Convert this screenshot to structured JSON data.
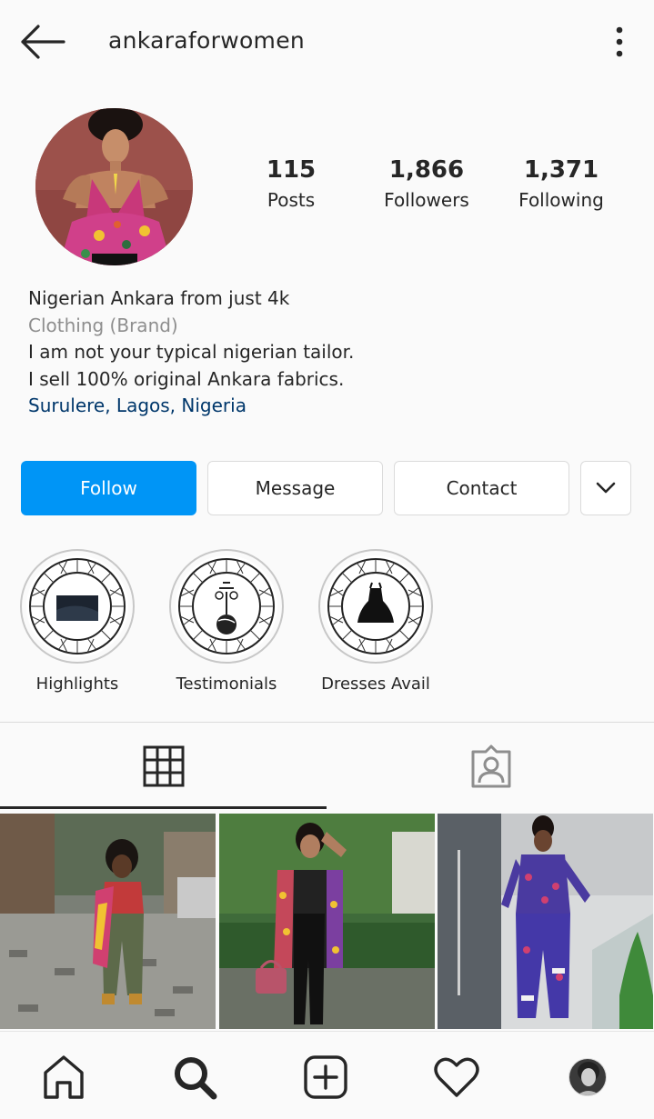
{
  "header": {
    "username": "ankaraforwomen",
    "back_icon": "arrow-left-icon",
    "more_icon": "more-vertical-icon"
  },
  "stats": {
    "posts_count": "115",
    "posts_label": "Posts",
    "followers_count": "1,866",
    "followers_label": "Followers",
    "following_count": "1,371",
    "following_label": "Following"
  },
  "bio": {
    "name": "Nigerian Ankara from just 4k",
    "category": "Clothing (Brand)",
    "line1": "I am not your typical nigerian tailor.",
    "line2": "I sell 100% original Ankara fabrics.",
    "location": "Surulere, Lagos, Nigeria"
  },
  "actions": {
    "follow_label": "Follow",
    "message_label": "Message",
    "contact_label": "Contact",
    "more_icon": "chevron-down-icon"
  },
  "highlights": [
    {
      "label": "Highlights"
    },
    {
      "label": "Testimonials"
    },
    {
      "label": "Dresses Avail"
    }
  ],
  "tabs": {
    "grid_icon": "grid-icon",
    "tagged_icon": "tagged-person-icon"
  },
  "nav": {
    "home_icon": "home-icon",
    "search_icon": "search-icon",
    "add_icon": "add-post-icon",
    "activity_icon": "heart-icon",
    "profile_icon": "profile-avatar"
  },
  "colors": {
    "accent": "#0095f6",
    "location_link": "#00376b",
    "muted_text": "#8e8e8e"
  }
}
